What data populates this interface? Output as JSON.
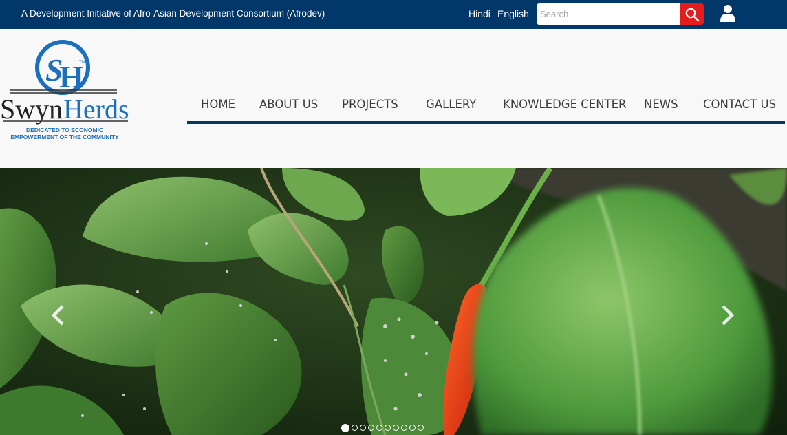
{
  "topbar": {
    "tagline": "A Development Initiative of Afro-Asian Development Consortium (Afrodev)",
    "languages": [
      "Hindi",
      "English"
    ],
    "search_placeholder": "Search"
  },
  "logo": {
    "brand": "SwynHerds",
    "monogram": "SH",
    "trademark": "TM",
    "caption_line1": "DEDICATED TO ECONOMIC",
    "caption_line2": "EMPOWERMENT OF THE COMMUNITY"
  },
  "nav": [
    "HOME",
    "ABOUT US",
    "PROJECTS",
    "GALLERY",
    "KNOWLEDGE CENTER",
    "NEWS",
    "CONTACT US"
  ],
  "slider": {
    "image": "leaves-red-chili-photo",
    "total_slides": 10,
    "active_slide": 1
  },
  "colors": {
    "topbar": "#023769",
    "search_button": "#e51c1c",
    "nav_text": "#3a3a3a",
    "logo_blue": "#1b6fbc"
  }
}
